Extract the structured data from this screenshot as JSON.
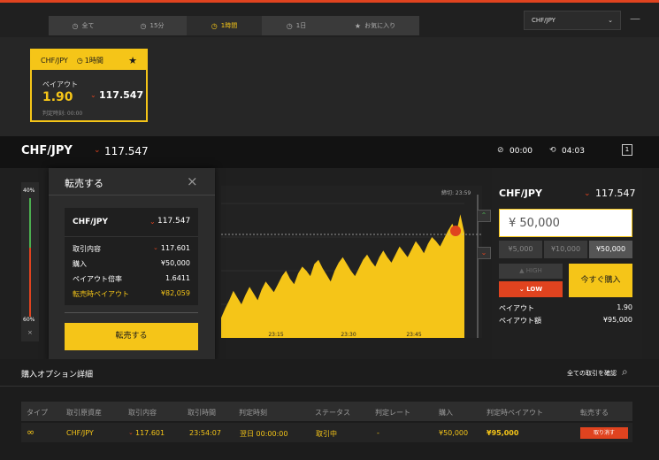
{
  "tabs": [
    {
      "icon": "clock-icon",
      "label": "全て"
    },
    {
      "icon": "clock-icon",
      "label": "15分"
    },
    {
      "icon": "clock-icon",
      "label": "1時間"
    },
    {
      "icon": "clock-icon",
      "label": "1日"
    },
    {
      "icon": "star-icon",
      "label": "お気に入り"
    }
  ],
  "symbol_select": {
    "value": "CHF/JPY"
  },
  "card": {
    "symbol": "CHF/JPY",
    "period": "1時間",
    "payout_label": "ペイアウト",
    "payout": "1.90",
    "price": "117.547",
    "judge_time": "判定時刻: 00:00"
  },
  "asset": {
    "symbol": "CHF/JPY",
    "price": "117.547",
    "countdown1": "00:00",
    "countdown2": "04:03",
    "rate": "117.547",
    "close_time": "締切: 23:59"
  },
  "gauge": {
    "top": "40%",
    "bottom": "60%",
    "close": "×"
  },
  "chart_data": {
    "type": "area",
    "x_ticks": [
      "23:15",
      "23:30",
      "23:45"
    ],
    "values": [
      0.15,
      0.22,
      0.28,
      0.35,
      0.3,
      0.25,
      0.32,
      0.38,
      0.33,
      0.28,
      0.36,
      0.42,
      0.38,
      0.34,
      0.4,
      0.46,
      0.5,
      0.44,
      0.4,
      0.48,
      0.53,
      0.5,
      0.46,
      0.55,
      0.58,
      0.52,
      0.47,
      0.42,
      0.5,
      0.56,
      0.6,
      0.55,
      0.5,
      0.46,
      0.52,
      0.58,
      0.62,
      0.57,
      0.53,
      0.6,
      0.65,
      0.6,
      0.56,
      0.62,
      0.68,
      0.64,
      0.6,
      0.66,
      0.72,
      0.68,
      0.63,
      0.7,
      0.75,
      0.72,
      0.68,
      0.74,
      0.8,
      0.85,
      0.78,
      0.92,
      0.78
    ],
    "colors": {
      "fill": "#f5c518"
    }
  },
  "modal": {
    "title": "転売する",
    "symbol": "CHF/JPY",
    "price": "117.547",
    "rows": [
      {
        "label": "取引内容",
        "value": "117.601"
      },
      {
        "label": "購入",
        "value": "¥50,000"
      },
      {
        "label": "ペイアウト倍率",
        "value": "1.6411"
      }
    ],
    "payout_row": {
      "label": "転売時ペイアウト",
      "value": "¥82,059"
    },
    "button": "転売する"
  },
  "trade": {
    "symbol": "CHF/JPY",
    "price": "117.547",
    "amount": "¥ 50,000",
    "presets": [
      "¥5,000",
      "¥10,000",
      "¥50,000"
    ],
    "high": "HIGH",
    "low": "LOW",
    "buy_now": "今すぐ購入",
    "payout_label": "ペイアウト",
    "payout": "1.90",
    "payout_amount_label": "ペイアウト額",
    "payout_amount": "¥95,000"
  },
  "details": {
    "title": "購入オプション詳細",
    "view_all": "全ての取引を確認",
    "headers": [
      "タイプ",
      "取引原資産",
      "取引内容",
      "取引時間",
      "判定時刻",
      "ステータス",
      "判定レート",
      "購入",
      "判定時ペイアウト",
      "転売する"
    ],
    "row": {
      "asset": "CHF/JPY",
      "content": "117.601",
      "time": "23:54:07",
      "judge": "翌日 00:00:00",
      "status": "取引中",
      "rate": "-",
      "amount": "¥50,000",
      "payout": "¥95,000",
      "action": "取り消す"
    }
  },
  "colors": {
    "accent": "#f5c518",
    "down": "#e0431f",
    "up": "#4caf50"
  }
}
